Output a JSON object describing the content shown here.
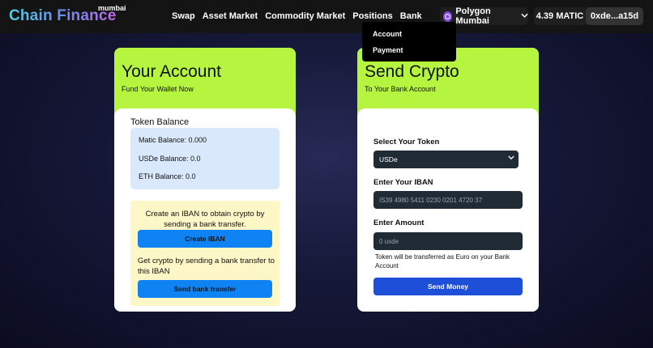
{
  "header": {
    "logo": "Chain Finance",
    "network_tag": "mumbai",
    "nav": [
      "Swap",
      "Asset Market",
      "Commodity Market",
      "Positions",
      "Bank"
    ],
    "chain": "Polygon Mumbai",
    "balance": "4.39 MATIC",
    "account": "0xde...a15d"
  },
  "bank_menu": {
    "items": [
      "Account",
      "Payment"
    ]
  },
  "account_card": {
    "title": "Your Account",
    "subtitle": "Fund Your Wallet Now",
    "token_balance_label": "Token Balance",
    "balances": [
      "Matic Balance: 0.000",
      "USDe Balance: 0.0",
      "ETH Balance: 0.0"
    ],
    "iban_prompt": "Create an IBAN to obtain crypto by sending a bank transfer.",
    "create_iban_label": "Create IBAN",
    "transfer_prompt": "Get crypto by sending a bank transfer to this IBAN",
    "send_transfer_label": "Send bank transfer"
  },
  "send_card": {
    "title": "Send Crypto",
    "subtitle": "To Your Bank Account",
    "token_label": "Select Your Token",
    "token_value": "USDe",
    "iban_label": "Enter Your IBAN",
    "iban_placeholder": "IS39 4980 5411 0230 0201 4720 37",
    "amount_label": "Enter Amount",
    "amount_placeholder": "0 usde",
    "note": "Token will be transferred as Euro on your Bank Account",
    "send_label": "Send Money"
  },
  "colors": {
    "card_header": "#b5f43f",
    "primary_button": "#0f83f3",
    "send_button": "#1d4fd8",
    "balance_box": "#d9e9fb",
    "iban_box": "#fdf6c6"
  },
  "icons": {
    "chain": "polygon-icon",
    "dropdown": "chevron-down-icon"
  }
}
